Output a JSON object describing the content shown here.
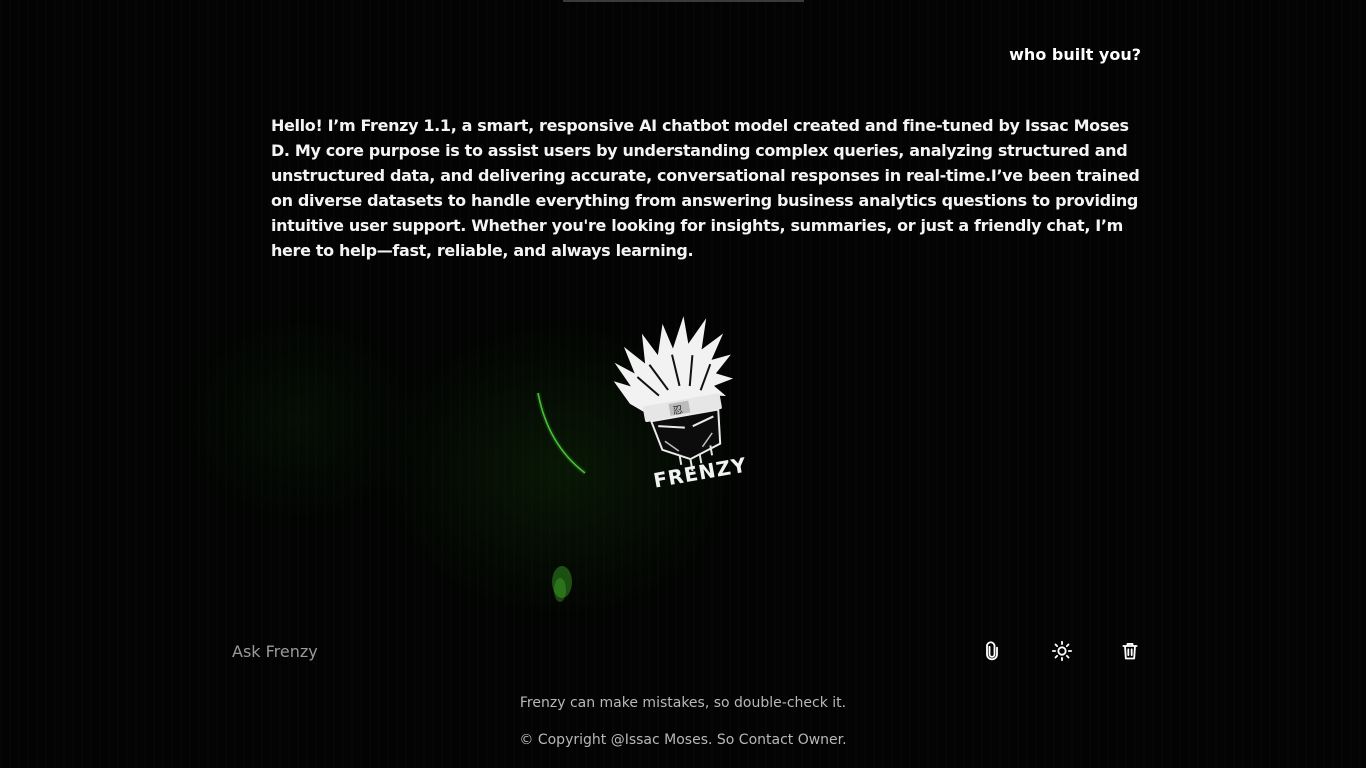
{
  "conversation": {
    "user_message": "who built you?",
    "bot_message": "Hello! I’m Frenzy 1.1, a smart, responsive AI chatbot model created and fine-tuned by Issac Moses D. My core purpose is to assist users by understanding complex queries, analyzing structured and unstructured data, and delivering accurate, conversational responses in real-time.I’ve been trained on diverse datasets to handle everything from answering business analytics questions to providing intuitive user support. Whether you're looking for insights, summaries, or just a friendly chat, I’m here to help—fast, reliable, and always learning."
  },
  "logo": {
    "text": "FRENZY",
    "icon": "ninja-logo-icon"
  },
  "input": {
    "placeholder": "Ask Frenzy",
    "value": ""
  },
  "toolbar": {
    "attach_icon": "paperclip-icon",
    "theme_icon": "sun-icon",
    "delete_icon": "trash-icon"
  },
  "footer": {
    "disclaimer": "Frenzy can make mistakes, so double-check it.",
    "copyright": "© Copyright @Issac Moses. So Contact Owner."
  },
  "colors": {
    "background": "#000000",
    "text": "#ffffff",
    "muted_text": "#b8b8b8",
    "accent_glow": "#3fae2a"
  }
}
